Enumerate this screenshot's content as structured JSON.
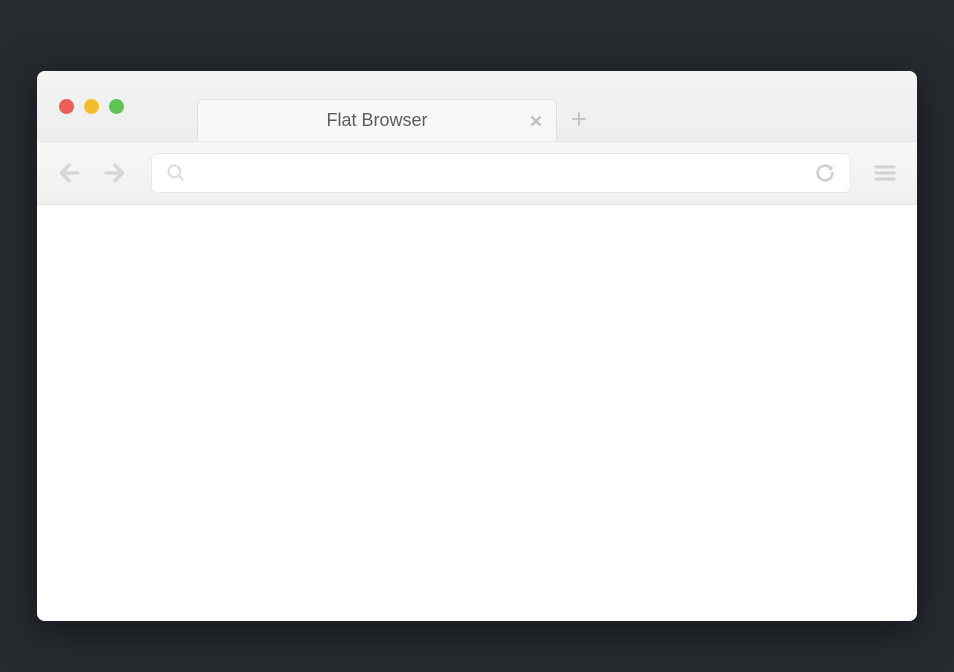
{
  "window": {
    "traffic_lights": {
      "red": "#ec5f57",
      "yellow": "#f5bc2f",
      "green": "#61c454"
    }
  },
  "tabs": [
    {
      "title": "Flat Browser"
    }
  ],
  "address_bar": {
    "value": "",
    "placeholder": ""
  },
  "icons": {
    "close": "close-icon",
    "new_tab": "plus-icon",
    "back": "arrow-left-icon",
    "forward": "arrow-right-icon",
    "search": "search-icon",
    "reload": "reload-icon",
    "menu": "hamburger-icon"
  }
}
